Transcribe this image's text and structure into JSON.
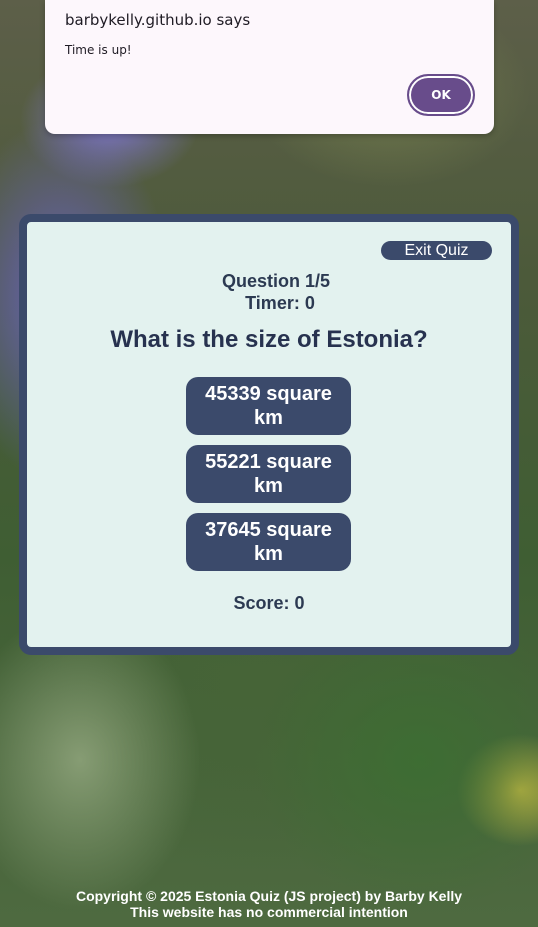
{
  "alert": {
    "title": "barbykelly.github.io says",
    "message": "Time is up!",
    "ok_label": "OK"
  },
  "quiz": {
    "exit_label": "Exit Quiz",
    "question_counter": "Question 1/5",
    "timer": "Timer: 0",
    "question": "What is the size of Estonia?",
    "answers": [
      {
        "label": "45339 square km"
      },
      {
        "label": "55221 square km"
      },
      {
        "label": "37645 square km"
      }
    ],
    "score": "Score: 0"
  },
  "footer": {
    "copyright": "Copyright © 2025 Estonia Quiz (JS project) by Barby Kelly",
    "notice": "This website has no commercial intention"
  },
  "colors": {
    "primary": "#3b4a6b",
    "card_background": "#e3f2ef",
    "alert_button": "#684c8b"
  }
}
